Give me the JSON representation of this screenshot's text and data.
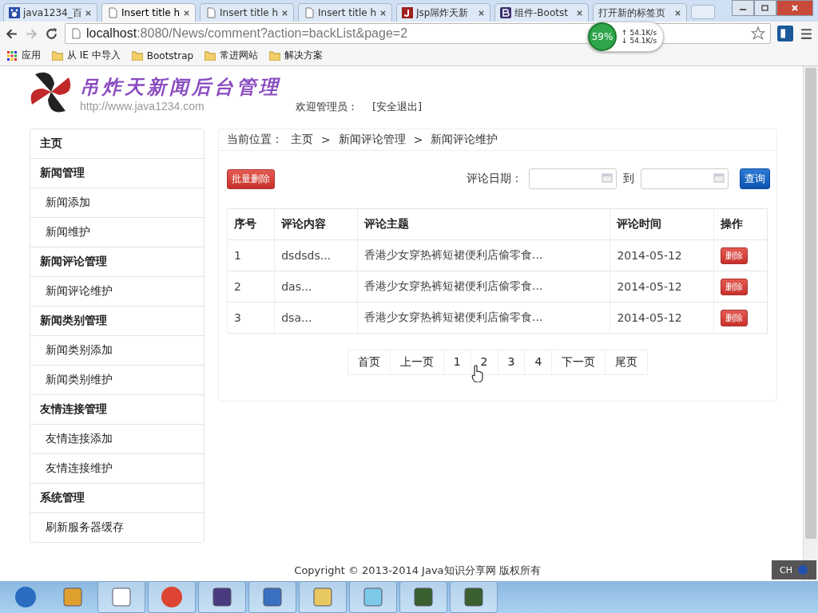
{
  "browser": {
    "tabs": [
      {
        "title": "java1234_百",
        "kind": "paw",
        "selected": false
      },
      {
        "title": "Insert title h",
        "kind": "page",
        "selected": true
      },
      {
        "title": "Insert title h",
        "kind": "page",
        "selected": false
      },
      {
        "title": "Insert title h",
        "kind": "page",
        "selected": false
      },
      {
        "title": "Jsp屌炸天新",
        "kind": "j",
        "selected": false
      },
      {
        "title": "组件-Bootst",
        "kind": "b",
        "selected": false
      },
      {
        "title": "打开新的标签页",
        "kind": "blank",
        "selected": false
      }
    ],
    "url_host": "localhost",
    "url_rest": ":8080/News/comment?action=backList&page=2",
    "bookmarks": [
      {
        "label": "应用",
        "kind": "apps"
      },
      {
        "label": "从 IE 中导入",
        "kind": "folder"
      },
      {
        "label": "Bootstrap",
        "kind": "folder"
      },
      {
        "label": "常进网站",
        "kind": "folder"
      },
      {
        "label": "解决方案",
        "kind": "folder"
      }
    ],
    "net_widget": {
      "percent": "59%",
      "up": "↑ 54.1K/s",
      "down": "↓ 54.1K/s"
    }
  },
  "header": {
    "logo_title": "吊炸天新闻后台管理",
    "logo_url": "http://www.java1234.com",
    "welcome": "欢迎管理员：",
    "logout": "[安全退出]"
  },
  "sidebar": {
    "items": [
      {
        "label": "主页",
        "kind": "header"
      },
      {
        "label": "新闻管理",
        "kind": "header"
      },
      {
        "label": "新闻添加",
        "kind": "sub"
      },
      {
        "label": "新闻维护",
        "kind": "sub"
      },
      {
        "label": "新闻评论管理",
        "kind": "header"
      },
      {
        "label": "新闻评论维护",
        "kind": "sub"
      },
      {
        "label": "新闻类别管理",
        "kind": "header"
      },
      {
        "label": "新闻类别添加",
        "kind": "sub"
      },
      {
        "label": "新闻类别维护",
        "kind": "sub"
      },
      {
        "label": "友情连接管理",
        "kind": "header"
      },
      {
        "label": "友情连接添加",
        "kind": "sub"
      },
      {
        "label": "友情连接维护",
        "kind": "sub"
      },
      {
        "label": "系统管理",
        "kind": "header"
      },
      {
        "label": "刷新服务器缓存",
        "kind": "sub"
      }
    ]
  },
  "breadcrumb": {
    "label": "当前位置：",
    "items": [
      "主页",
      "新闻评论管理",
      "新闻评论维护"
    ],
    "separator": ">"
  },
  "toolbar": {
    "batch_delete": "批量删除",
    "date_label": "评论日期：",
    "to": "到",
    "search": "查询"
  },
  "table": {
    "columns": [
      "序号",
      "评论内容",
      "评论主题",
      "评论时间",
      "操作"
    ],
    "rows": [
      {
        "cells": [
          "1",
          "dsdsds...",
          "香港少女穿热裤短裙便利店偷零食...",
          "2014-05-12"
        ],
        "action": "删除"
      },
      {
        "cells": [
          "2",
          "das...",
          "香港少女穿热裤短裙便利店偷零食...",
          "2014-05-12"
        ],
        "action": "删除"
      },
      {
        "cells": [
          "3",
          "dsa...",
          "香港少女穿热裤短裙便利店偷零食...",
          "2014-05-12"
        ],
        "action": "删除"
      }
    ]
  },
  "pagination": [
    "首页",
    "上一页",
    "1",
    "2",
    "3",
    "4",
    "下一页",
    "尾页"
  ],
  "footer": "Copyright © 2013-2014 Java知识分享网 版权所有",
  "taskbar": {
    "ime": "CH"
  }
}
